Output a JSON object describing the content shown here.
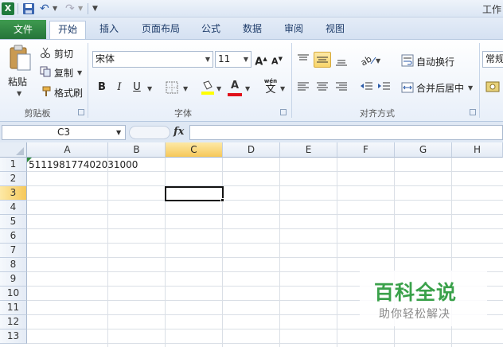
{
  "window": {
    "title": "工作"
  },
  "qat": {
    "logo": "X",
    "undo": "↶",
    "redo": "↷",
    "dropdown": "▼"
  },
  "tabs": {
    "file": "文件",
    "items": [
      "开始",
      "插入",
      "页面布局",
      "公式",
      "数据",
      "审阅",
      "视图"
    ],
    "active": "开始"
  },
  "clipboard": {
    "paste": "粘贴",
    "cut": "剪切",
    "copy": "复制",
    "format_painter": "格式刷",
    "group_label": "剪贴板"
  },
  "font": {
    "name": "宋体",
    "size": "11",
    "bold": "B",
    "italic": "I",
    "underline": "U",
    "font_color_letter": "A",
    "wen": "wén",
    "wen_char": "文",
    "group_label": "字体"
  },
  "alignment": {
    "wrap_text": "自动换行",
    "merge_center": "合并后居中",
    "group_label": "对齐方式"
  },
  "number": {
    "format": "常规"
  },
  "formula_bar": {
    "name_box": "C3",
    "fx": "fx",
    "value": ""
  },
  "columns": [
    "A",
    "B",
    "C",
    "D",
    "E",
    "F",
    "G",
    "H"
  ],
  "rows": [
    "1",
    "2",
    "3",
    "4",
    "5",
    "6",
    "7",
    "8",
    "9",
    "10",
    "11",
    "12",
    "13"
  ],
  "selected": {
    "column": "C",
    "row": "3"
  },
  "cells": {
    "A1": "511198177402031000"
  },
  "watermark": {
    "title": "百科全说",
    "subtitle": "助你轻松解决"
  },
  "colors": {
    "file_tab": "#2f8a3d",
    "selection_header": "#f6c85a",
    "watermark_green": "#3aa14a"
  }
}
